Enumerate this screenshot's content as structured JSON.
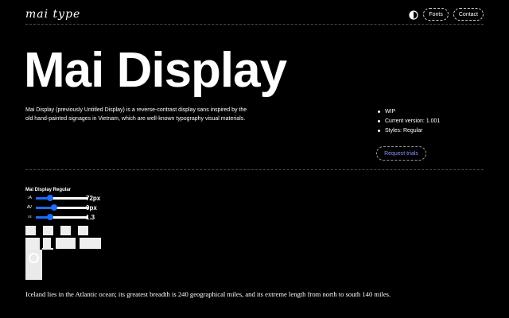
{
  "header": {
    "logo_text": "mai type",
    "theme_toggle_icon": "half-circle-contrast-icon",
    "nav": [
      {
        "label": "Fonts"
      },
      {
        "label": "Contact"
      }
    ]
  },
  "hero": {
    "title": "Mai Display",
    "description": "Mai Display (previously Untitled Display) is a reverse-contrast display sans inspired by the old hand-painted signages in Vietnam, which are well-known typography visual materials.",
    "meta": [
      "WIP",
      "Current version: 1.001",
      "Styles: Regular"
    ],
    "request_button": "Request trials"
  },
  "specimen": {
    "style_label": "Mai Display Regular",
    "controls": [
      {
        "icon": "font-size-icon",
        "glyph": "↕A",
        "value": "72px",
        "level": 0.28
      },
      {
        "icon": "letter-spacing-icon",
        "glyph": "AV",
        "value": "0px",
        "level": 0.35
      },
      {
        "icon": "line-height-icon",
        "glyph": "↕≡",
        "value": "1.3",
        "level": 0.28
      }
    ],
    "sample_text": "Iceland lies in the Atlantic ocean; its greatest breadth is 240 geographical miles, and its extreme length from north to south 140 miles."
  },
  "colors": {
    "background": "#000000",
    "text": "#ffffff",
    "accent": "#1f6bff",
    "link": "#8c8cff"
  }
}
